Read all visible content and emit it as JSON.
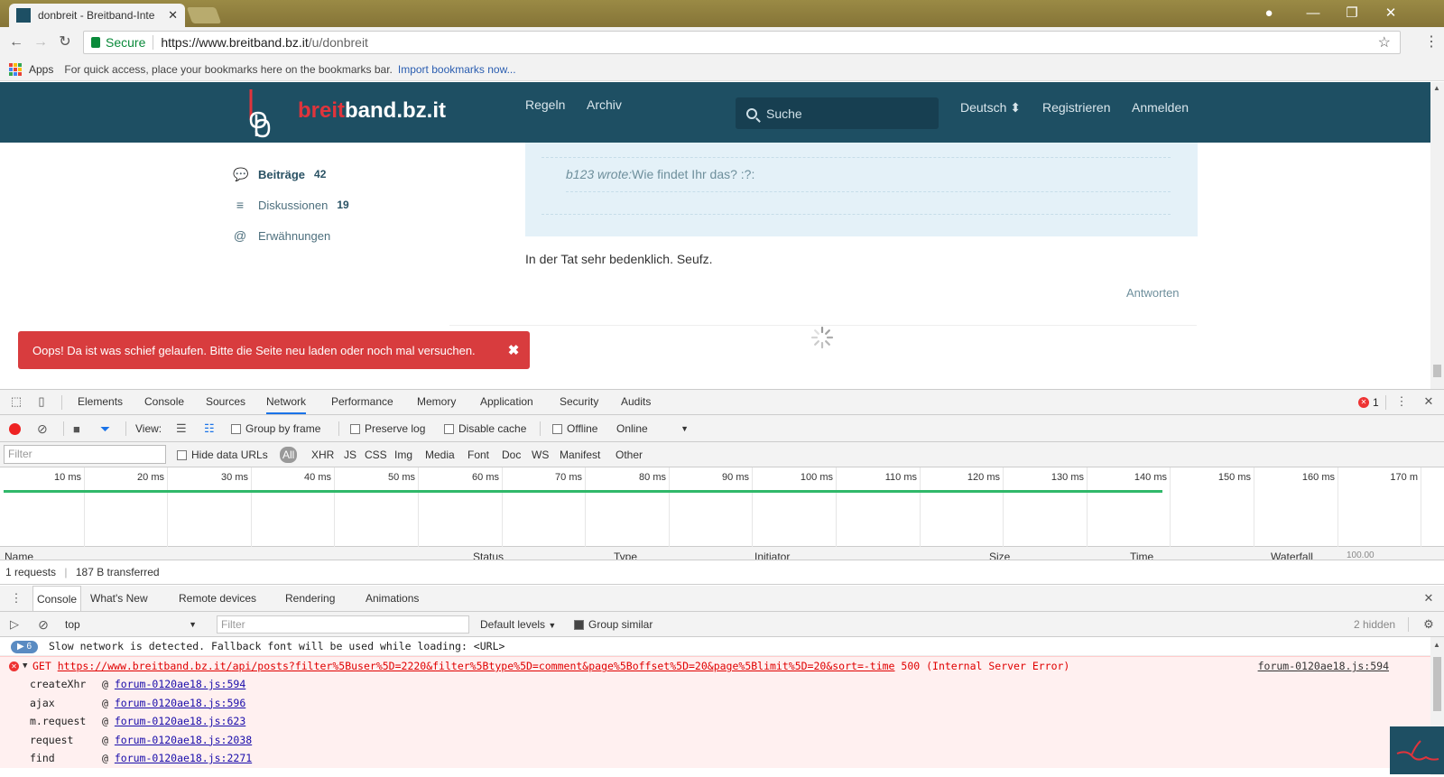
{
  "browser": {
    "tab_title": "donbreit - Breitband-Inte",
    "address": {
      "secure_label": "Secure",
      "url_host": "https://www.breitband.bz.it",
      "url_path": "/u/donbreit"
    },
    "bookmarks": {
      "apps_label": "Apps",
      "hint": "For quick access, place your bookmarks here on the bookmarks bar.",
      "import_link": "Import bookmarks now..."
    }
  },
  "forum": {
    "logo": {
      "brand_red": "breit",
      "brand_white": "band.bz.it"
    },
    "nav": {
      "rules": "Regeln",
      "archive": "Archiv"
    },
    "search_placeholder": "Suche",
    "language": "Deutsch",
    "register": "Registrieren",
    "login": "Anmelden",
    "sidebar": [
      {
        "label": "Beiträge",
        "count": "42"
      },
      {
        "label": "Diskussionen",
        "count": "19"
      },
      {
        "label": "Erwähnungen",
        "count": ""
      }
    ],
    "quote": {
      "author": "b123 wrote:",
      "text": "Wie findet Ihr das? :?:"
    },
    "post_text": "In der Tat sehr bedenklich. Seufz.",
    "reply": "Antworten",
    "error_alert": "Oops! Da ist was schief gelaufen. Bitte die Seite neu laden oder noch mal versuchen.",
    "colors": {
      "header": "#1e4f63",
      "error": "#d83c3e",
      "accent_red": "#e0343c"
    }
  },
  "devtools": {
    "tabs": [
      "Elements",
      "Console",
      "Sources",
      "Network",
      "Performance",
      "Memory",
      "Application",
      "Security",
      "Audits"
    ],
    "active_tab": "Network",
    "error_count": "1",
    "network_toolbar": {
      "view_label": "View:",
      "group_by_frame": "Group by frame",
      "preserve_log": "Preserve log",
      "disable_cache": "Disable cache",
      "offline": "Offline",
      "throttle": "Online"
    },
    "filter_placeholder": "Filter",
    "hide_data_urls": "Hide data URLs",
    "type_filters": [
      "All",
      "XHR",
      "JS",
      "CSS",
      "Img",
      "Media",
      "Font",
      "Doc",
      "WS",
      "Manifest",
      "Other"
    ],
    "timeline_ticks": [
      "10 ms",
      "20 ms",
      "30 ms",
      "40 ms",
      "50 ms",
      "60 ms",
      "70 ms",
      "80 ms",
      "90 ms",
      "100 ms",
      "110 ms",
      "120 ms",
      "130 ms",
      "140 ms",
      "150 ms",
      "160 ms",
      "170 m"
    ],
    "table_columns": [
      "Name",
      "Status",
      "Type",
      "Initiator",
      "Size",
      "Time",
      "Waterfall",
      "100.00"
    ],
    "summary": {
      "requests": "1 requests",
      "transferred": "187 B transferred"
    },
    "drawer_tabs": [
      "Console",
      "What's New",
      "Remote devices",
      "Rendering",
      "Animations"
    ],
    "console_toolbar": {
      "context": "top",
      "filter_placeholder": "Filter",
      "levels": "Default levels",
      "group_similar": "Group similar",
      "hidden": "2 hidden"
    },
    "console": {
      "info_count": "6",
      "info_message": "Slow network is detected. Fallback font will be used while loading: <URL>",
      "error": {
        "method": "GET",
        "url": "https://www.breitband.bz.it/api/posts?filter%5Buser%5D=2220&filter%5Btype%5D=comment&page%5Boffset%5D=20&page%5Blimit%5D=20&sort=-time",
        "status": "500 (Internal Server Error)",
        "source": "forum-0120ae18.js:594"
      },
      "trace": [
        {
          "fn": "createXhr",
          "src": "forum-0120ae18.js:594"
        },
        {
          "fn": "ajax",
          "src": "forum-0120ae18.js:596"
        },
        {
          "fn": "m.request",
          "src": "forum-0120ae18.js:623"
        },
        {
          "fn": "request",
          "src": "forum-0120ae18.js:2038"
        },
        {
          "fn": "find",
          "src": "forum-0120ae18.js:2271"
        }
      ]
    }
  }
}
